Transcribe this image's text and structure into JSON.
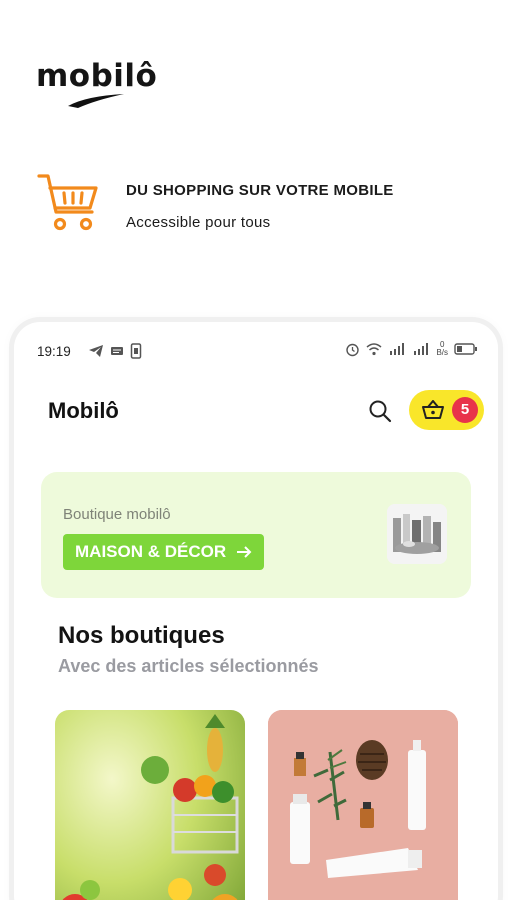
{
  "brand": {
    "logo_text": "mobilô"
  },
  "promo": {
    "title": "DU SHOPPING SUR VOTRE MOBILE",
    "subtitle": "Accessible pour tous",
    "icon": "shopping-cart-icon",
    "accent_color": "#f28a1c"
  },
  "statusbar": {
    "time": "19:19",
    "speed_value": "0",
    "speed_unit": "B/s"
  },
  "app": {
    "title": "Mobilô",
    "cart_count": "5",
    "cart_color": "#f9e62a",
    "badge_color": "#e8334a"
  },
  "banner": {
    "subtitle": "Boutique mobilô",
    "button_label": "MAISON & DÉCOR",
    "button_color": "#7ed63a",
    "background": "#eefadb"
  },
  "shops": {
    "title": "Nos boutiques",
    "subtitle": "Avec des articles sélectionnés"
  }
}
